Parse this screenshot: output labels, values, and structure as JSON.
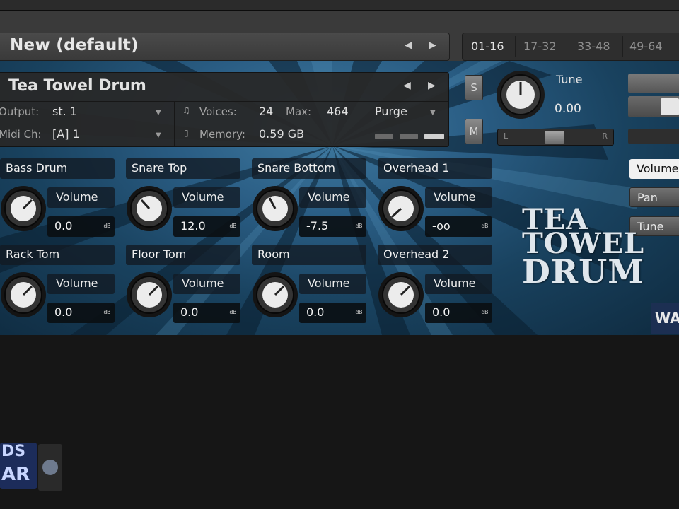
{
  "rack": {
    "preset_name": "New (default)",
    "pages": [
      "01-16",
      "17-32",
      "33-48",
      "49-64"
    ]
  },
  "instrument": {
    "title": "Tea Towel Drum",
    "output_label": "Output:",
    "output_value": "st. 1",
    "midi_label": "Midi Ch:",
    "midi_value": "[A]  1",
    "voices_label": "Voices:",
    "voices_value": "24",
    "max_label": "Max:",
    "max_value": "464",
    "memory_label": "Memory:",
    "memory_value": "0.59 GB",
    "purge_label": "Purge",
    "solo_label": "S",
    "mute_label": "M",
    "tune_label": "Tune",
    "tune_value": "0.00",
    "pan_left": "L",
    "pan_right": "R"
  },
  "right_tabs": [
    "Volume",
    "Pan",
    "Tune"
  ],
  "channels": [
    {
      "name": "Bass Drum",
      "param": "Volume",
      "value": "0.0",
      "unit": "dB"
    },
    {
      "name": "Snare Top",
      "param": "Volume",
      "value": "12.0",
      "unit": "dB"
    },
    {
      "name": "Snare Bottom",
      "param": "Volume",
      "value": "-7.5",
      "unit": "dB"
    },
    {
      "name": "Overhead 1",
      "param": "Volume",
      "value": "-oo",
      "unit": "dB"
    },
    {
      "name": "Rack Tom",
      "param": "Volume",
      "value": "0.0",
      "unit": "dB"
    },
    {
      "name": "Floor Tom",
      "param": "Volume",
      "value": "0.0",
      "unit": "dB"
    },
    {
      "name": "Room",
      "param": "Volume",
      "value": "0.0",
      "unit": "dB"
    },
    {
      "name": "Overhead 2",
      "param": "Volume",
      "value": "0.0",
      "unit": "dB"
    }
  ],
  "logo": {
    "line1": "TEA",
    "line2": "TOWEL",
    "line3": "DRUM"
  },
  "brand": "WA",
  "watermark": {
    "line1": "DS",
    "line2": "AR"
  },
  "colors": {
    "panel_bg": "#2a5d84",
    "header_bg": "#282828",
    "active_tab": "#f1f1f1"
  }
}
